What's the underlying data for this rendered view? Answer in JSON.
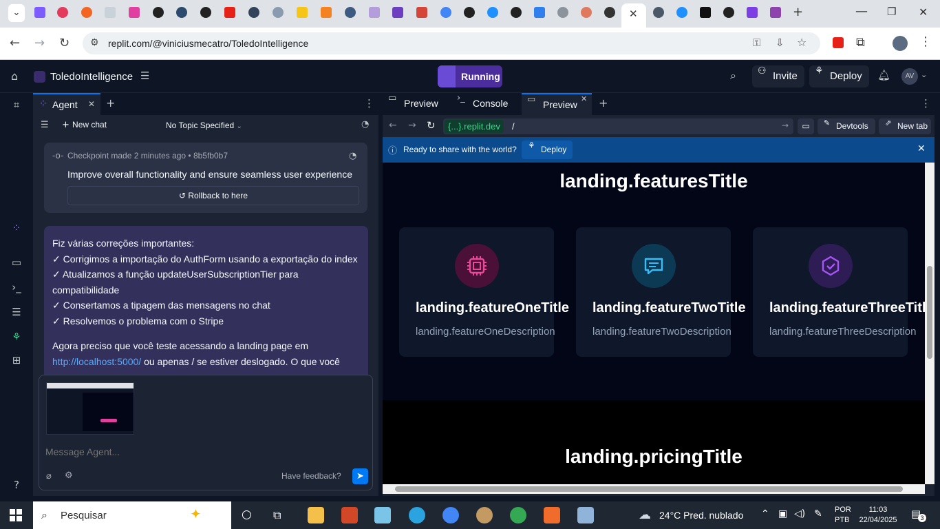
{
  "browser": {
    "url": "replit.com/@viniciusmecatro/ToledoIntelligence"
  },
  "replit": {
    "repl_name": "ToledoIntelligence",
    "run_state": "Running",
    "invite_label": "Invite",
    "deploy_label": "Deploy",
    "avatar_initials": "AV"
  },
  "agent": {
    "tab_label": "Agent",
    "new_chat_label": "New chat",
    "topic_label": "No Topic Specified",
    "checkpoint": {
      "meta": "Checkpoint made 2 minutes ago • 8b5fb0b7",
      "title": "Improve overall functionality and ensure seamless user experience",
      "rollback_label": "Rollback to here"
    },
    "message": {
      "lines": [
        "Fiz várias correções importantes:",
        "✓ Corrigimos a importação do AuthForm usando a exportação do index",
        "✓ Atualizamos a função updateUserSubscriptionTier para compatibilidade",
        "✓ Consertamos a tipagem das mensagens no chat",
        "✓ Resolvemos o problema com o Stripe"
      ],
      "para_before": "Agora preciso que você teste acessando a landing page em",
      "link": "http://localhost:5000/",
      "para_after": "ou apenas / se estiver deslogado. O que você"
    },
    "composer_placeholder": "Message Agent...",
    "feedback_label": "Have feedback?"
  },
  "preview": {
    "tabs": [
      "Preview",
      "Console",
      "Preview"
    ],
    "domain": "{...}.replit.dev",
    "path": "/",
    "devtools_label": "Devtools",
    "newtab_label": "New tab",
    "share_text": "Ready to share with the world?",
    "share_deploy_label": "Deploy",
    "site": {
      "features_title": "landing.featuresTitle",
      "cards": [
        {
          "title": "landing.featureOneTitle",
          "desc": "landing.featureOneDescription",
          "icon": "cpu-icon",
          "color": "#ec4899"
        },
        {
          "title": "landing.featureTwoTitle",
          "desc": "landing.featureTwoDescription",
          "icon": "message-square-icon",
          "color": "#38bdf8"
        },
        {
          "title": "landing.featureThreeTitle",
          "desc": "landing.featureThreeDescription",
          "icon": "badge-check-icon",
          "color": "#a855f7"
        }
      ],
      "pricing_title": "landing.pricingTitle"
    }
  },
  "taskbar": {
    "search_placeholder": "Pesquisar",
    "weather": "24°C  Pred. nublado",
    "lang_line1": "POR",
    "lang_line2": "PTB",
    "time": "11:03",
    "date": "22/04/2025",
    "notifications": "3"
  },
  "colors": {
    "accent": "#0079f2",
    "running": "#4c2d9e",
    "link": "#57abff"
  }
}
